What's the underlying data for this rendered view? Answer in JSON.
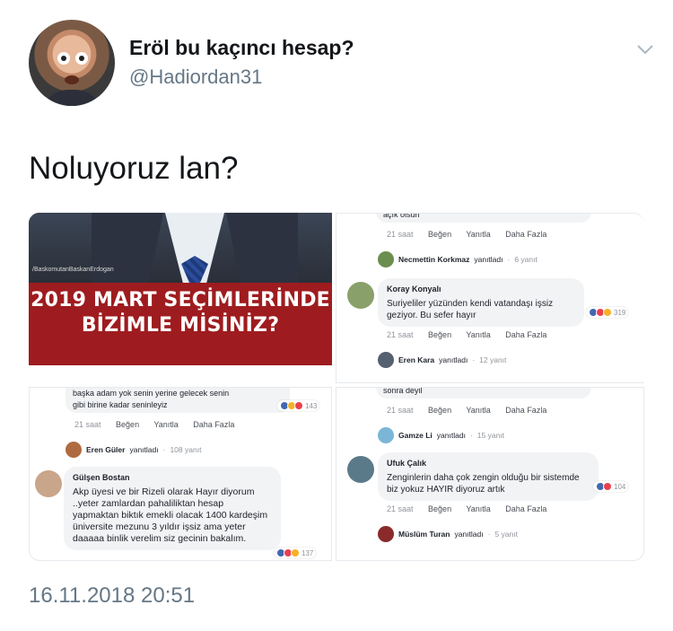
{
  "author": {
    "display_name": "Eröl bu kaçıncı hesap?",
    "handle": "@Hadiordan31"
  },
  "tweet": {
    "text": "Noluyoruz lan?",
    "timestamp": "16.11.2018 20:51"
  },
  "image": {
    "banner_line1": "2019 MART SEÇİMLERİNDE",
    "banner_line2": "BİZİMLE MİSİNİZ?",
    "watermark": "/BaskomutanBaskanErdogan"
  },
  "comments": {
    "meta_time": "21 saat",
    "meta_like": "Beğen",
    "meta_reply": "Yanıtla",
    "meta_more": "Daha Fazla",
    "replied": "yanıtladı",
    "top_right_cut": "açık olsun",
    "necmettin": {
      "name": "Necmettin Korkmaz",
      "count": "6 yanıt"
    },
    "koray": {
      "name": "Koray Konyalı",
      "text": "Suriyeliler yüzünden kendi vatandaşı işsiz geziyor. Bu sefer hayır",
      "reacts": "319"
    },
    "eren_kara": {
      "name": "Eren Kara",
      "count": "12 yanıt"
    },
    "bottom_left_cut1": "başka adam yok senin yerine gelecek senin",
    "bottom_left_cut2": "gibi birine kadar seninleyiz",
    "bottom_left_cut_reacts": "143",
    "eren_guler": {
      "name": "Eren Güler",
      "count": "108 yanıt"
    },
    "gulsen": {
      "name": "Gülşen Bostan",
      "text": "Akp üyesi ve bir Rizeli olarak Hayır diyorum ..yeter zamlardan pahaliliktan hesap yapmaktan biktık emekli olacak 1400 kardeşim üniversite mezunu 3 yıldır işsiz ama yeter daaaaa binlik verelim siz gecinin bakalım.",
      "reacts": "137"
    },
    "bottom_right_cut": "sonra deyil",
    "gamze": {
      "name": "Gamze Li",
      "count": "15 yanıt"
    },
    "ufuk": {
      "name": "Ufuk Çalık",
      "text": "Zenginlerin daha çok zengin olduğu bir sistemde biz yokuz HAYIR diyoruz artık",
      "reacts": "104"
    },
    "muslum": {
      "name": "Müslüm Turan",
      "count": "5 yanıt"
    }
  }
}
